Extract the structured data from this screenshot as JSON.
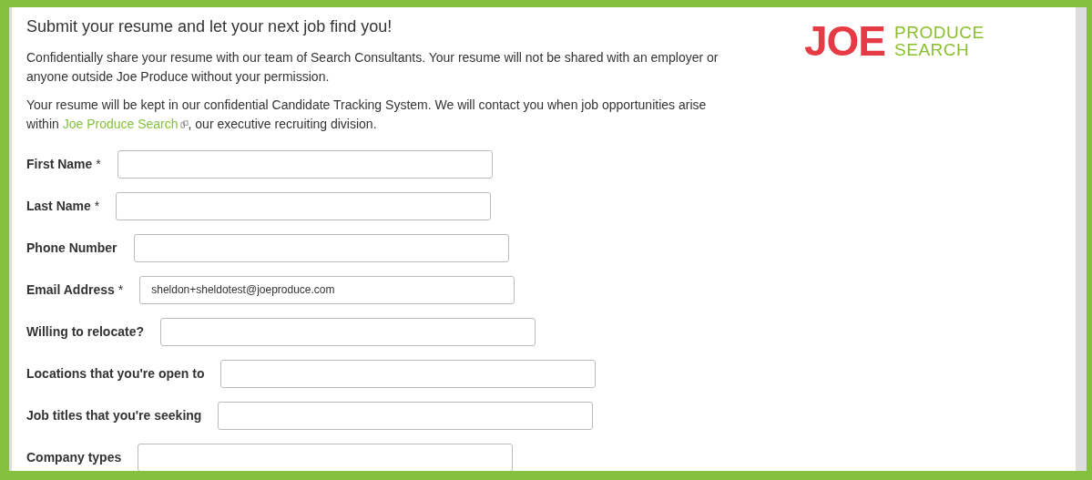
{
  "heading": "Submit your resume and let your next job find you!",
  "paragraphs": [
    {
      "text": "Confidentially share your resume with our team of Search Consultants. Your resume will not be shared with an employer or anyone outside Joe Produce without your permission."
    },
    {
      "text": "Your resume will be kept in our confidential Candidate Tracking System. We will contact you when job opportunities arise within ",
      "link": "Joe Produce Search",
      "after": ", our executive recruiting division."
    }
  ],
  "logo": {
    "primary": "JOE",
    "secondary": [
      "PRODUCE",
      "SEARCH"
    ]
  },
  "fields": [
    {
      "label": "First Name",
      "required_mark": "*"
    },
    {
      "label": "Last Name",
      "required_mark": "*"
    },
    {
      "label": "Phone Number"
    },
    {
      "label": "Email Address",
      "required_mark": "*",
      "value": "sheldon+sheldotest@joeproduce.com"
    },
    {
      "label": "Willing to relocate?"
    },
    {
      "label": "Locations that you're open to"
    },
    {
      "label": "Job titles that you're seeking"
    },
    {
      "label": "Company types"
    }
  ]
}
